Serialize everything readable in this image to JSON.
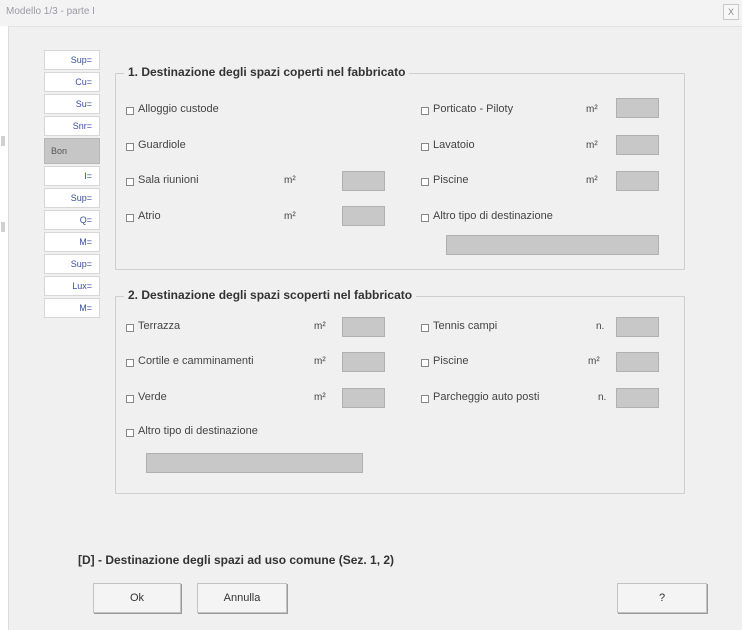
{
  "window": {
    "title": "Modello 1/3 - parte I",
    "close_label": "X"
  },
  "sidebar": {
    "items": [
      {
        "label": "Sup="
      },
      {
        "label": "Cu="
      },
      {
        "label": "Su=",
        "extra": ""
      },
      {
        "label": "Snr="
      },
      {
        "label": "Bon",
        "active": true
      },
      {
        "label": "I="
      },
      {
        "label": "Sup="
      },
      {
        "label": "Q="
      },
      {
        "label": "M="
      },
      {
        "label": "Sup="
      },
      {
        "label": "Lux="
      },
      {
        "label": "M="
      }
    ]
  },
  "section1": {
    "title": "1. Destinazione degli spazi coperti nel fabbricato",
    "left": [
      {
        "label": "Alloggio custode",
        "unit": ""
      },
      {
        "label": "Guardiole",
        "unit": ""
      },
      {
        "label": "Sala riunioni",
        "unit": "m²"
      },
      {
        "label": "Atrio",
        "unit": "m²"
      }
    ],
    "right": [
      {
        "label": "Porticato - Piloty",
        "unit": "m²"
      },
      {
        "label": "Lavatoio",
        "unit": "m²"
      },
      {
        "label": "Piscine",
        "unit": "m²"
      },
      {
        "label": "Altro tipo di destinazione",
        "unit": ""
      }
    ]
  },
  "section2": {
    "title": "2. Destinazione degli spazi scoperti nel fabbricato",
    "left": [
      {
        "label": "Terrazza",
        "unit": "m²"
      },
      {
        "label": "Cortile e camminamenti",
        "unit": "m²"
      },
      {
        "label": "Verde",
        "unit": "m²"
      },
      {
        "label": "Altro tipo di destinazione",
        "unit": ""
      }
    ],
    "right": [
      {
        "label": "Tennis campi",
        "unit": "n."
      },
      {
        "label": "Piscine",
        "unit": "m²"
      },
      {
        "label": "Parcheggio auto posti",
        "unit": "n."
      }
    ]
  },
  "footer": {
    "title": "[D] - Destinazione degli spazi ad uso comune (Sez. 1, 2)",
    "ok_label": "Ok",
    "cancel_label": "Annulla",
    "help_label": "?"
  }
}
